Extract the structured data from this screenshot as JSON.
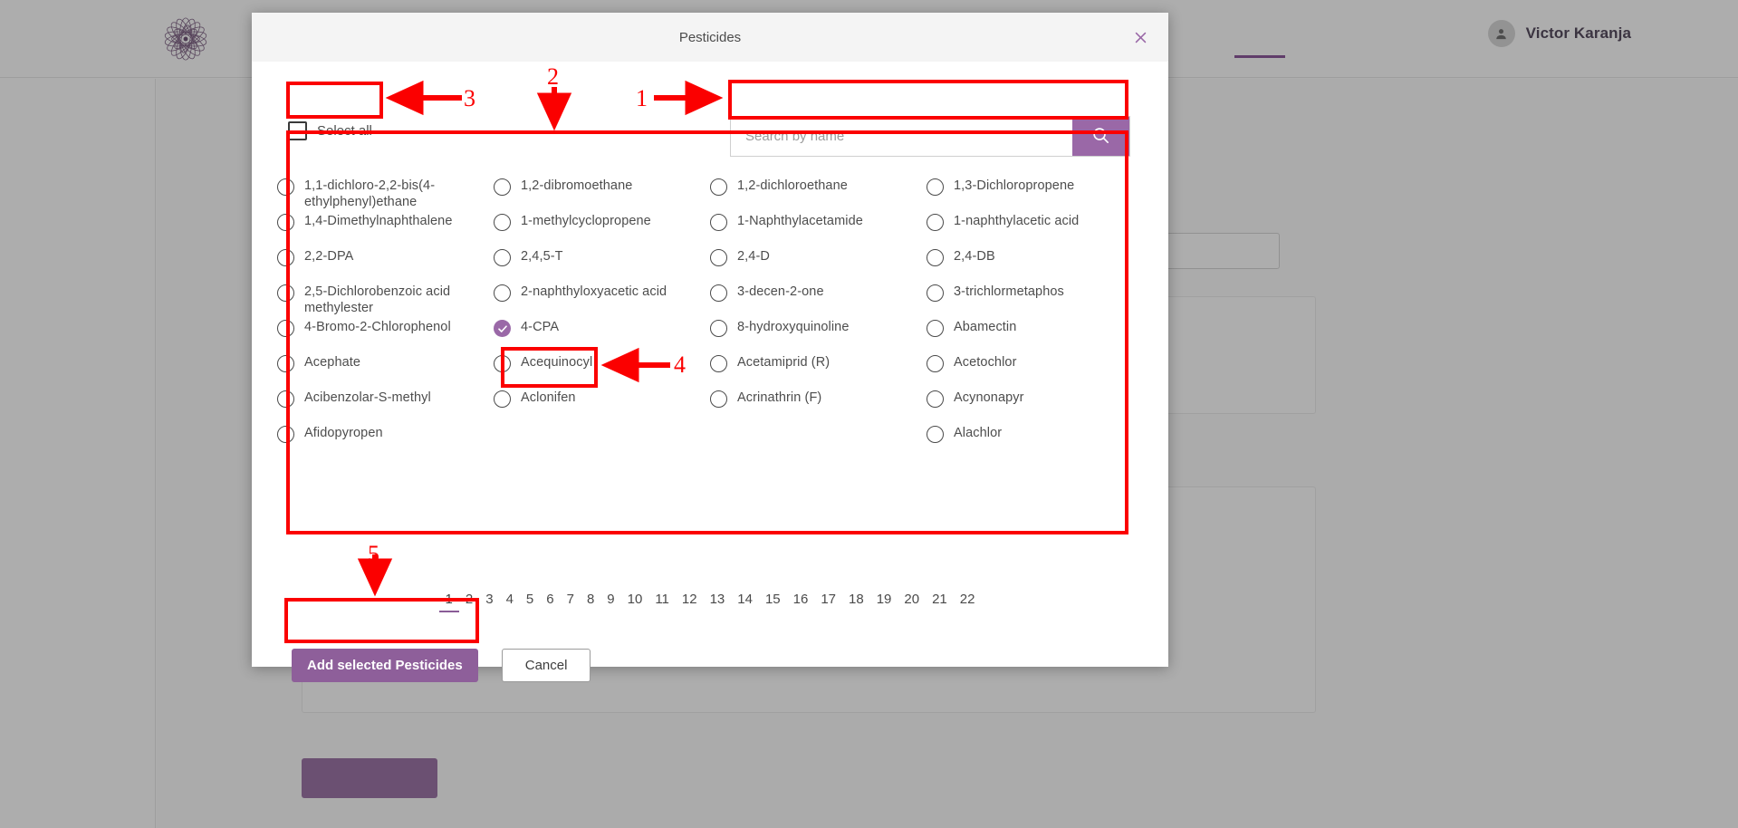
{
  "app": {
    "logo_icon": "flower-mandala-logo",
    "user": {
      "name": "Victor Karanja",
      "avatar_icon": "user-avatar-icon"
    }
  },
  "modal": {
    "title": "Pesticides",
    "close_icon": "close-icon",
    "select_all": {
      "label": "Select all",
      "checked": false
    },
    "search": {
      "placeholder": "Search by name",
      "value": "",
      "button_icon": "search-icon",
      "button_color": "#9a68a7"
    },
    "options": [
      [
        {
          "label": "1,1-dichloro-2,2-bis(4-ethylphenyl)ethane",
          "checked": false
        },
        {
          "label": "1,2-dibromoethane",
          "checked": false
        },
        {
          "label": "1,2-dichloroethane",
          "checked": false
        },
        {
          "label": "1,3-Dichloropropene",
          "checked": false
        }
      ],
      [
        {
          "label": "1,4-Dimethylnaphthalene",
          "checked": false
        },
        {
          "label": "1-methylcyclopropene",
          "checked": false
        },
        {
          "label": "1-Naphthylacetamide",
          "checked": false
        },
        {
          "label": "1-naphthylacetic acid",
          "checked": false
        }
      ],
      [
        {
          "label": "2,2-DPA",
          "checked": false
        },
        {
          "label": "2,4,5-T",
          "checked": false
        },
        {
          "label": "2,4-D",
          "checked": false
        },
        {
          "label": "2,4-DB",
          "checked": false
        }
      ],
      [
        {
          "label": "2,5-Dichlorobenzoic acid methylester",
          "checked": false
        },
        {
          "label": "2-naphthyloxyacetic acid",
          "checked": false
        },
        {
          "label": "3-decen-2-one",
          "checked": false
        },
        {
          "label": "3-trichlormetaphos",
          "checked": false
        }
      ],
      [
        {
          "label": "4-Bromo-2-Chlorophenol",
          "checked": false
        },
        {
          "label": "4-CPA",
          "checked": true
        },
        {
          "label": "8-hydroxyquinoline",
          "checked": false
        },
        {
          "label": "Abamectin",
          "checked": false
        }
      ],
      [
        {
          "label": "Acephate",
          "checked": false
        },
        {
          "label": "Acequinocyl",
          "checked": false
        },
        {
          "label": "Acetamiprid (R)",
          "checked": false
        },
        {
          "label": "Acetochlor",
          "checked": false
        }
      ],
      [
        {
          "label": "Acibenzolar-S-methyl",
          "checked": false
        },
        {
          "label": "Aclonifen",
          "checked": false
        },
        {
          "label": "Acrinathrin (F)",
          "checked": false
        },
        {
          "label": "Acynonapyr",
          "checked": false
        }
      ],
      [
        {
          "label": "Afidopyropen",
          "checked": false
        },
        {
          "label": "",
          "checked": false
        },
        {
          "label": "",
          "checked": false
        },
        {
          "label": "Alachlor",
          "checked": false
        }
      ]
    ],
    "pagination": {
      "pages": [
        "1",
        "2",
        "3",
        "4",
        "5",
        "6",
        "7",
        "8",
        "9",
        "10",
        "11",
        "12",
        "13",
        "14",
        "15",
        "16",
        "17",
        "18",
        "19",
        "20",
        "21",
        "22"
      ],
      "active": "1"
    },
    "footer": {
      "primary_label": "Add selected Pesticides",
      "secondary_label": "Cancel"
    }
  },
  "annotations": {
    "accent_color": "#fb0000",
    "markers": [
      {
        "id": "1",
        "label": "1",
        "target": "search-input"
      },
      {
        "id": "2",
        "label": "2",
        "target": "options-grid"
      },
      {
        "id": "3",
        "label": "3",
        "target": "select-all-checkbox"
      },
      {
        "id": "4",
        "label": "4",
        "target": "option-4-cpa"
      },
      {
        "id": "5",
        "label": "5",
        "target": "add-selected-pesticides-button"
      }
    ]
  }
}
